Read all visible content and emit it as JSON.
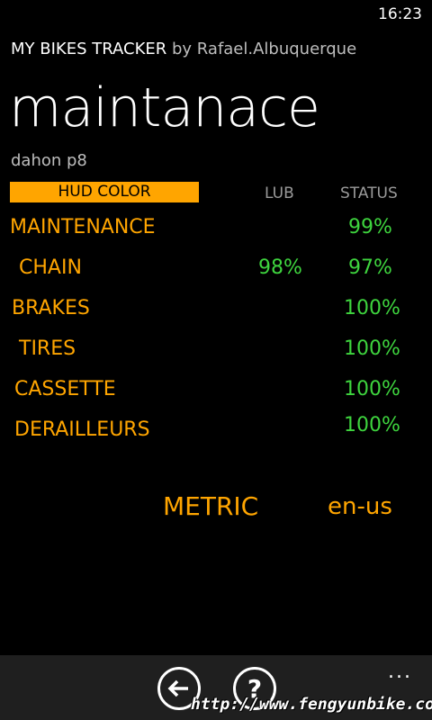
{
  "status_bar": {
    "time": "16:23"
  },
  "header": {
    "app_name": "MY BIKES TRACKER",
    "author": "by Rafael.Albuquerque",
    "page_title": "maintanace",
    "bike_name": "dahon p8"
  },
  "table": {
    "hud_label": "HUD COLOR",
    "col_lub": "LUB",
    "col_status": "STATUS",
    "rows": [
      {
        "label": "MAINTENANCE",
        "lub": "",
        "status": "99%"
      },
      {
        "label": "CHAIN",
        "lub": "98%",
        "status": "97%"
      },
      {
        "label": "BRAKES",
        "lub": "",
        "status": "100%"
      },
      {
        "label": "TIRES",
        "lub": "",
        "status": "100%"
      },
      {
        "label": "CASSETTE",
        "lub": "",
        "status": "100%"
      },
      {
        "label": "DERAILLEURS",
        "lub": "",
        "status": "100%"
      }
    ]
  },
  "settings": {
    "units": "METRIC",
    "locale": "en-us"
  },
  "appbar": {
    "back_icon": "arrow-left-icon",
    "help_icon": "question-icon",
    "more": "..."
  },
  "watermark": "http://www.fengyunbike.com",
  "colors": {
    "accent": "#ffa500",
    "ok": "#3ed43e",
    "background": "#000000"
  }
}
